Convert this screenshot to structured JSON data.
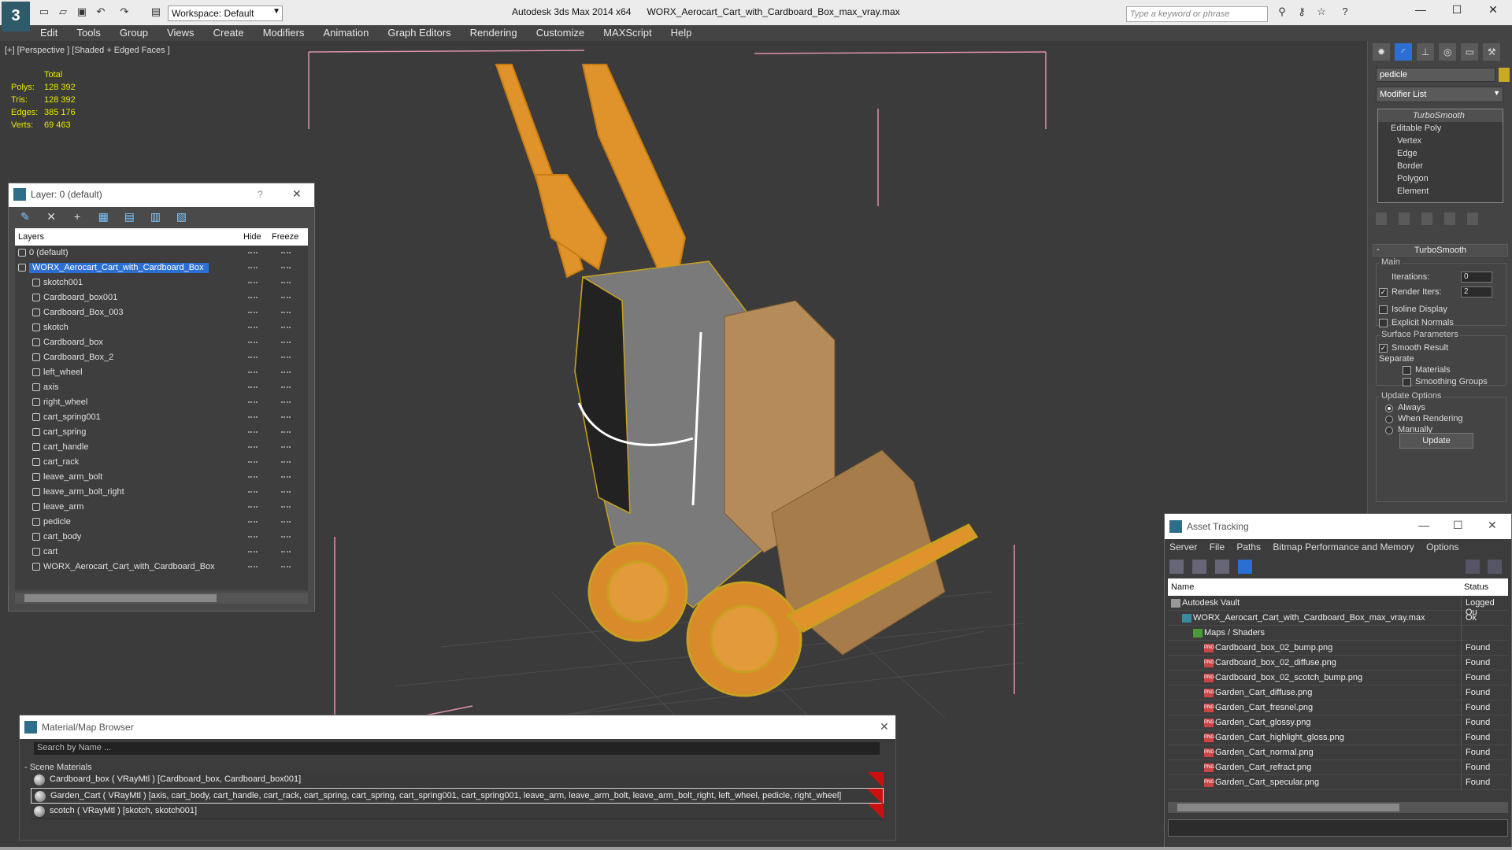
{
  "title_bar": {
    "app_name": "Autodesk 3ds Max  2014 x64",
    "file_name": "WORX_Aerocart_Cart_with_Cardboard_Box_max_vray.max",
    "workspace": "Workspace: Default",
    "search_placeholder": "Type a keyword or phrase"
  },
  "menu": [
    "Edit",
    "Tools",
    "Group",
    "Views",
    "Create",
    "Modifiers",
    "Animation",
    "Graph Editors",
    "Rendering",
    "Customize",
    "MAXScript",
    "Help"
  ],
  "viewport": {
    "label": "[+] [Perspective ] [Shaded + Edged Faces ]",
    "stats": {
      "header": "Total",
      "rows": [
        {
          "label": "Polys:",
          "value": "128 392"
        },
        {
          "label": "Tris:",
          "value": "128 392"
        },
        {
          "label": "Edges:",
          "value": "385 176"
        },
        {
          "label": "Verts:",
          "value": "69 463"
        }
      ]
    }
  },
  "layer_panel": {
    "title": "Layer: 0 (default)",
    "help": "?",
    "columns": {
      "layers": "Layers",
      "hide": "Hide",
      "freeze": "Freeze"
    },
    "layers": [
      {
        "name": "0 (default)",
        "level": 0
      },
      {
        "name": "WORX_Aerocart_Cart_with_Cardboard_Box",
        "level": 0,
        "selected": true
      },
      {
        "name": "skotch001",
        "level": 1
      },
      {
        "name": "Cardboard_box001",
        "level": 1
      },
      {
        "name": "Cardboard_Box_003",
        "level": 1
      },
      {
        "name": "skotch",
        "level": 1
      },
      {
        "name": "Cardboard_box",
        "level": 1
      },
      {
        "name": "Cardboard_Box_2",
        "level": 1
      },
      {
        "name": "left_wheel",
        "level": 1
      },
      {
        "name": "axis",
        "level": 1
      },
      {
        "name": "right_wheel",
        "level": 1
      },
      {
        "name": "cart_spring001",
        "level": 1
      },
      {
        "name": "cart_spring",
        "level": 1
      },
      {
        "name": "cart_handle",
        "level": 1
      },
      {
        "name": "cart_rack",
        "level": 1
      },
      {
        "name": "leave_arm_bolt",
        "level": 1
      },
      {
        "name": "leave_arm_bolt_right",
        "level": 1
      },
      {
        "name": "leave_arm",
        "level": 1
      },
      {
        "name": "pedicle",
        "level": 1
      },
      {
        "name": "cart_body",
        "level": 1
      },
      {
        "name": "cart",
        "level": 1
      },
      {
        "name": "WORX_Aerocart_Cart_with_Cardboard_Box",
        "level": 1
      }
    ]
  },
  "material_browser": {
    "title": "Material/Map Browser",
    "search_placeholder": "Search by Name ...",
    "section": "- Scene Materials",
    "materials": [
      {
        "text": "Cardboard_box  ( VRayMtl ) [Cardboard_box, Cardboard_box001]"
      },
      {
        "text": "Garden_Cart  ( VRayMtl ) [axis, cart_body, cart_handle, cart_rack, cart_spring, cart_spring, cart_spring001, cart_spring001, leave_arm, leave_arm_bolt, leave_arm_bolt_right, left_wheel, pedicle, right_wheel]",
        "selected": true
      },
      {
        "text": "scotch  ( VRayMtl ) [skotch, skotch001]"
      }
    ]
  },
  "asset_tracking": {
    "title": "Asset Tracking",
    "menu": [
      "Server",
      "File",
      "Paths",
      "Bitmap Performance and Memory",
      "Options"
    ],
    "columns": {
      "name": "Name",
      "status": "Status"
    },
    "rows": [
      {
        "name": "Autodesk Vault",
        "status": "Logged Ou",
        "indent": 1,
        "kind": "vault"
      },
      {
        "name": "WORX_Aerocart_Cart_with_Cardboard_Box_max_vray.max",
        "status": "Ok",
        "indent": 2,
        "kind": "max"
      },
      {
        "name": "Maps / Shaders",
        "status": "",
        "indent": 3,
        "kind": "folder"
      },
      {
        "name": "Cardboard_box_02_bump.png",
        "status": "Found",
        "indent": 4,
        "kind": "png"
      },
      {
        "name": "Cardboard_box_02_diffuse.png",
        "status": "Found",
        "indent": 4,
        "kind": "png"
      },
      {
        "name": "Cardboard_box_02_scotch_bump.png",
        "status": "Found",
        "indent": 4,
        "kind": "png"
      },
      {
        "name": "Garden_Cart_diffuse.png",
        "status": "Found",
        "indent": 4,
        "kind": "png"
      },
      {
        "name": "Garden_Cart_fresnel.png",
        "status": "Found",
        "indent": 4,
        "kind": "png"
      },
      {
        "name": "Garden_Cart_glossy.png",
        "status": "Found",
        "indent": 4,
        "kind": "png"
      },
      {
        "name": "Garden_Cart_highlight_gloss.png",
        "status": "Found",
        "indent": 4,
        "kind": "png"
      },
      {
        "name": "Garden_Cart_normal.png",
        "status": "Found",
        "indent": 4,
        "kind": "png"
      },
      {
        "name": "Garden_Cart_refract.png",
        "status": "Found",
        "indent": 4,
        "kind": "png"
      },
      {
        "name": "Garden_Cart_specular.png",
        "status": "Found",
        "indent": 4,
        "kind": "png"
      }
    ]
  },
  "command_panel": {
    "object_name": "pedicle",
    "object_color": "#c8a928",
    "modifier_list": "Modifier List",
    "stack": [
      {
        "name": "TurboSmooth",
        "top": true
      },
      {
        "name": "Editable Poly",
        "sub": false
      },
      {
        "name": "Vertex",
        "sub": true
      },
      {
        "name": "Edge",
        "sub": true
      },
      {
        "name": "Border",
        "sub": true
      },
      {
        "name": "Polygon",
        "sub": true
      },
      {
        "name": "Element",
        "sub": true
      }
    ],
    "turbosmooth": {
      "rollout": "TurboSmooth",
      "main": "Main",
      "iterations_label": "Iterations:",
      "iterations_value": "0",
      "render_iters_label": "Render Iters:",
      "render_iters_value": "2",
      "render_iters_checked": true,
      "isoline": "Isoline Display",
      "explicit_normals": "Explicit Normals",
      "surface_params": "Surface Parameters",
      "smooth_result": "Smooth Result",
      "smooth_result_checked": true,
      "separate": "Separate",
      "materials": "Materials",
      "smoothing_groups": "Smoothing Groups",
      "update_options": "Update Options",
      "always": "Always",
      "when_rendering": "When Rendering",
      "manually": "Manually",
      "update_button": "Update"
    }
  }
}
